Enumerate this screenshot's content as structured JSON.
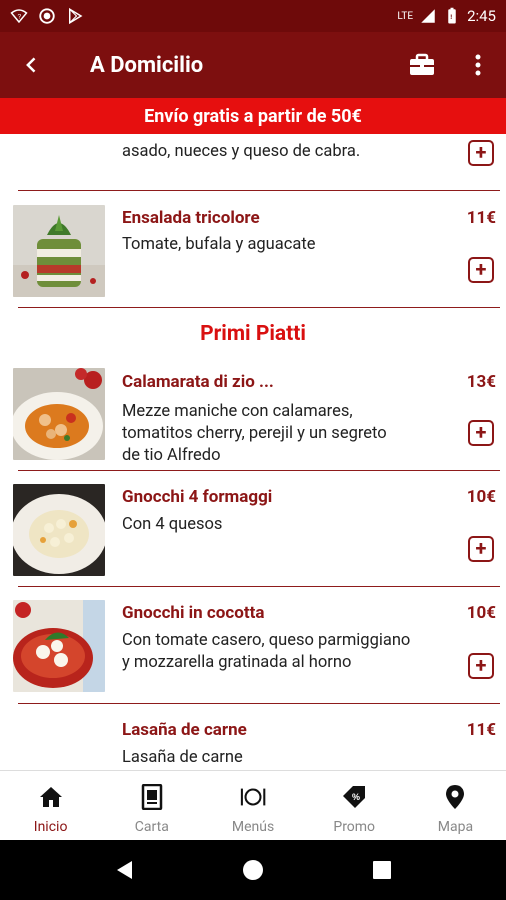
{
  "status_bar": {
    "time": "2:45",
    "network": "LTE"
  },
  "app_bar": {
    "title": "A Domicilio"
  },
  "banner": {
    "text": "Envío gratis a partir de 50€"
  },
  "items_top": {
    "partial_desc": "asado, nueces y queso de cabra."
  },
  "items": [
    {
      "name": "Ensalada tricolore",
      "price": "11€",
      "desc": "Tomate, bufala y aguacate"
    }
  ],
  "section": {
    "title": "Primi Piatti"
  },
  "items2": [
    {
      "name": "Calamarata  di zio  ...",
      "price": "13€",
      "desc_lines": [
        "Mezze maniche con calamares,",
        "tomatitos cherry, perejil y un segreto",
        "de tio Alfredo"
      ]
    },
    {
      "name": "Gnocchi 4 formaggi",
      "price": "10€",
      "desc_lines": [
        "Con 4 quesos"
      ]
    },
    {
      "name": "Gnocchi in cocotta",
      "price": "10€",
      "desc_lines": [
        "Con tomate casero, queso parmiggiano",
        "y mozzarella gratinada al horno"
      ]
    },
    {
      "name": "Lasaña de carne",
      "price": "11€",
      "desc_lines": [
        "Lasaña de carne"
      ]
    }
  ],
  "bottom_nav": [
    {
      "label": "Inicio",
      "icon": "home-icon",
      "active": true
    },
    {
      "label": "Carta",
      "icon": "menu-book-icon",
      "active": false
    },
    {
      "label": "Menús",
      "icon": "plate-cutlery-icon",
      "active": false
    },
    {
      "label": "Promo",
      "icon": "tag-icon",
      "active": false
    },
    {
      "label": "Mapa",
      "icon": "map-pin-icon",
      "active": false
    }
  ],
  "colors": {
    "primary_dark": "#6e0a0a",
    "primary": "#7d0f0f",
    "banner": "#e60f0f",
    "accent_text": "#8c1616",
    "section_title": "#d91010"
  }
}
